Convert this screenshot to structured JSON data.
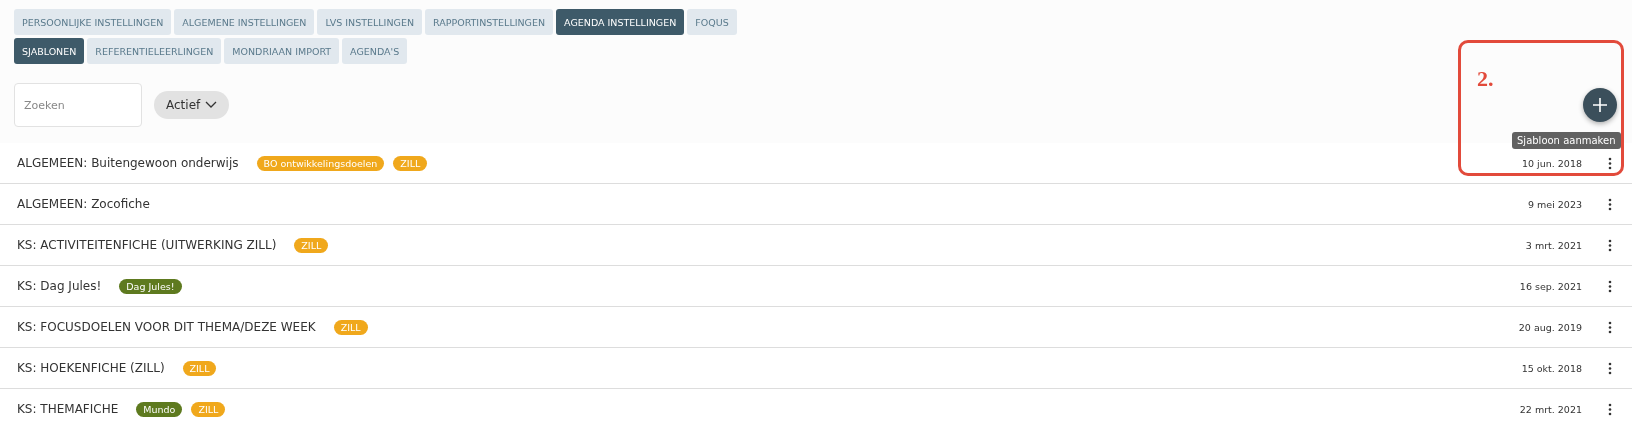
{
  "tabs": [
    {
      "label": "PERSOONLIJKE INSTELLINGEN",
      "selected": false
    },
    {
      "label": "ALGEMENE INSTELLINGEN",
      "selected": false
    },
    {
      "label": "LVS INSTELLINGEN",
      "selected": false
    },
    {
      "label": "RAPPORTINSTELLINGEN",
      "selected": false
    },
    {
      "label": "AGENDA INSTELLINGEN",
      "selected": true
    },
    {
      "label": "FOQUS",
      "selected": false
    }
  ],
  "subtabs": [
    {
      "label": "SJABLONEN",
      "selected": true
    },
    {
      "label": "REFERENTIELEERLINGEN",
      "selected": false
    },
    {
      "label": "MONDRIAAN IMPORT",
      "selected": false
    },
    {
      "label": "AGENDA'S",
      "selected": false
    }
  ],
  "search": {
    "placeholder": "Zoeken"
  },
  "filter": {
    "label": "Actief"
  },
  "add_button": {
    "tooltip": "Sjabloon aanmaken"
  },
  "annotation": {
    "label": "2."
  },
  "templates": [
    {
      "title": "ALGEMEEN: Buitengewoon onderwijs",
      "tags": [
        {
          "label": "BO ontwikkelingsdoelen",
          "color": "#f0a81c"
        },
        {
          "label": "ZILL",
          "color": "#f0a81c"
        }
      ],
      "date": "10 jun. 2018"
    },
    {
      "title": "ALGEMEEN: Zocofiche",
      "date": "9 mei 2023"
    },
    {
      "title": "KS: ACTIVITEITENFICHE (UITWERKING ZILL)",
      "tags": [
        {
          "label": "ZILL",
          "color": "#f0a81c"
        }
      ],
      "date": "3 mrt. 2021"
    },
    {
      "title": "KS: Dag Jules!",
      "tags": [
        {
          "label": "Dag Jules!",
          "color": "#5e7a1f"
        }
      ],
      "date": "16 sep. 2021"
    },
    {
      "title": "KS: FOCUSDOELEN VOOR DIT THEMA/DEZE WEEK",
      "tags": [
        {
          "label": "ZILL",
          "color": "#f0a81c"
        }
      ],
      "date": "20 aug. 2019"
    },
    {
      "title": "KS: HOEKENFICHE (ZILL)",
      "tags": [
        {
          "label": "ZILL",
          "color": "#f0a81c"
        }
      ],
      "date": "15 okt. 2018"
    },
    {
      "title": "KS: THEMAFICHE",
      "tags": [
        {
          "label": "Mundo",
          "color": "#5e7a1f"
        },
        {
          "label": "ZILL",
          "color": "#f0a81c"
        }
      ],
      "date": "22 mrt. 2021"
    }
  ]
}
